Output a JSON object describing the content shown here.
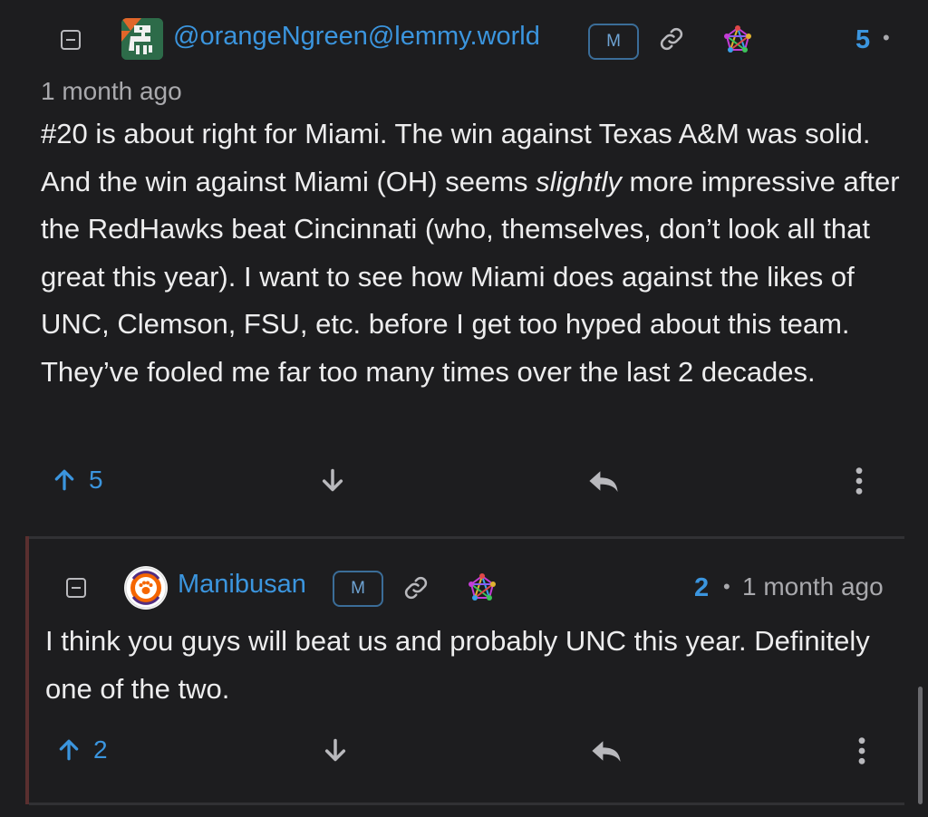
{
  "comments": [
    {
      "username": "@orangeNgreen@lemmy.world",
      "badge": "M",
      "score": "5",
      "separator": "•",
      "time": "1 month ago",
      "body": {
        "p1": "#20 is about right for Miami. The win against Texas A&M was solid. And the win against Miami (OH) seems ",
        "em": "slightly",
        "p2": " more impressive after the RedHawks beat Cincinnati (who, themselves, don’t look all that great this year). I want to see how Miami does against the likes of UNC, Clemson, FSU, etc. before I get too hyped about this team. They’ve fooled me far too many times over the last 2 decades."
      },
      "upvotes": "5"
    },
    {
      "username": "Manibusan",
      "badge": "M",
      "score": "2",
      "separator": "•",
      "time": "1 month ago",
      "avatar_text": "CLEMSON TIGERS",
      "body": "I think you guys will beat us and probably UNC this year. Definitely one of the two.",
      "upvotes": "2"
    }
  ],
  "colors": {
    "background": "#1d1d1f",
    "accent": "#3b95de",
    "thread_line": "#5a2f2f"
  },
  "icons": [
    "collapse-icon",
    "link-icon",
    "fediverse-icon",
    "upvote-icon",
    "downvote-icon",
    "reply-icon",
    "more-icon"
  ]
}
